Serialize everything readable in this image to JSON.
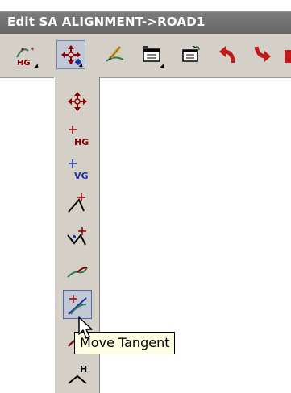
{
  "window": {
    "title": "Edit SA ALIGNMENT->ROAD1"
  },
  "toolbar": {
    "items": [
      {
        "name": "hg-tool",
        "icon": "hg-curve-icon",
        "has_dropdown": true
      },
      {
        "name": "move-tool",
        "icon": "move-arrows-icon",
        "has_dropdown": true,
        "active": true
      },
      {
        "name": "edit-tool",
        "icon": "pencil-curve-icon",
        "has_dropdown": false
      },
      {
        "name": "properties-tool",
        "icon": "properties-window-icon",
        "has_dropdown": true
      },
      {
        "name": "table-tool",
        "icon": "table-window-icon",
        "has_dropdown": false
      },
      {
        "name": "undo",
        "icon": "undo-arrow-icon",
        "has_dropdown": false
      },
      {
        "name": "redo",
        "icon": "redo-arrow-icon",
        "has_dropdown": false
      }
    ]
  },
  "flyout": {
    "items": [
      {
        "name": "move",
        "icon": "move-arrows-icon"
      },
      {
        "name": "move-hg",
        "icon": "move-hg-icon",
        "label": "HG"
      },
      {
        "name": "move-vg",
        "icon": "move-vg-icon",
        "label": "VG"
      },
      {
        "name": "move-pi",
        "icon": "move-pi-icon"
      },
      {
        "name": "move-pi-double",
        "icon": "move-pi-double-icon"
      },
      {
        "name": "move-curve",
        "icon": "move-curve-icon"
      },
      {
        "name": "move-tangent",
        "icon": "move-tangent-icon",
        "hovered": true
      },
      {
        "name": "move-curve-2",
        "icon": "move-curve-2-icon"
      },
      {
        "name": "move-h",
        "icon": "move-h-icon",
        "label": "H"
      }
    ]
  },
  "tooltip": {
    "text": "Move Tangent"
  },
  "colors": {
    "accent_red": "#8b0000",
    "accent_blue": "#1a2ea6",
    "curve_green": "#2e7d4f"
  }
}
